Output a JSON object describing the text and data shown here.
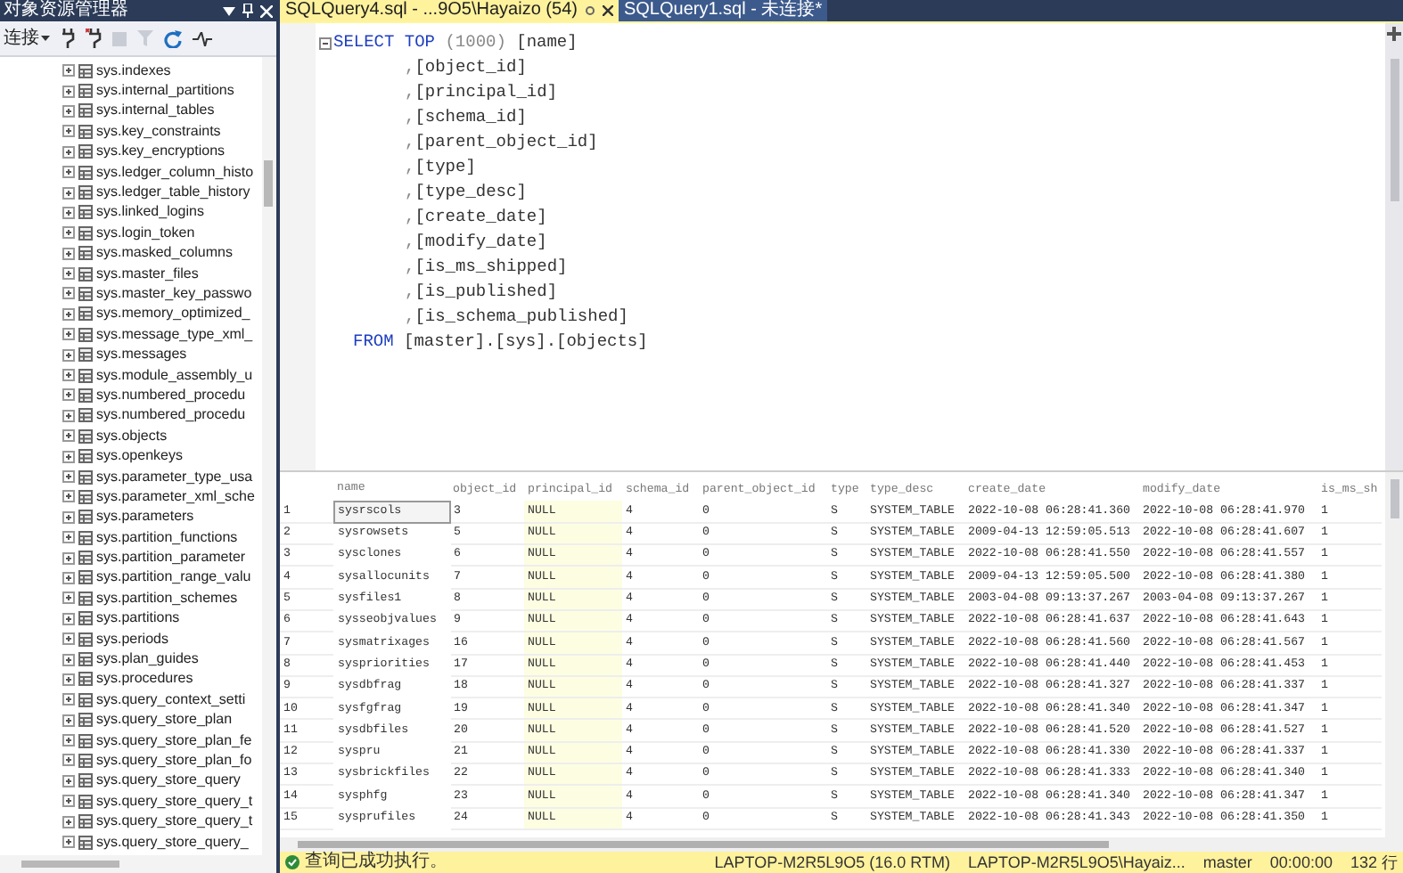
{
  "object_explorer": {
    "title": "对象资源管理器",
    "connect_label": "连接",
    "tree_items": [
      "sys.indexes",
      "sys.internal_partitions",
      "sys.internal_tables",
      "sys.key_constraints",
      "sys.key_encryptions",
      "sys.ledger_column_histo",
      "sys.ledger_table_history",
      "sys.linked_logins",
      "sys.login_token",
      "sys.masked_columns",
      "sys.master_files",
      "sys.master_key_passwo",
      "sys.memory_optimized_",
      "sys.message_type_xml_",
      "sys.messages",
      "sys.module_assembly_u",
      "sys.numbered_procedu",
      "sys.numbered_procedu",
      "sys.objects",
      "sys.openkeys",
      "sys.parameter_type_usa",
      "sys.parameter_xml_sche",
      "sys.parameters",
      "sys.partition_functions",
      "sys.partition_parameter",
      "sys.partition_range_valu",
      "sys.partition_schemes",
      "sys.partitions",
      "sys.periods",
      "sys.plan_guides",
      "sys.procedures",
      "sys.query_context_setti",
      "sys.query_store_plan",
      "sys.query_store_plan_fe",
      "sys.query_store_plan_fo",
      "sys.query_store_query",
      "sys.query_store_query_t",
      "sys.query_store_query_t",
      "sys.query_store_query_"
    ]
  },
  "tabs": [
    {
      "label": "SQLQuery4.sql - ...9O5\\Hayaizo (54)",
      "selected": true
    },
    {
      "label": "SQLQuery1.sql - 未连接*",
      "selected": false
    }
  ],
  "editor": {
    "lines": [
      {
        "kind": "select",
        "tokens": [
          {
            "kind": "keyword",
            "text": "SELECT TOP"
          },
          {
            "kind": "punct",
            "text": " (1000) "
          },
          {
            "kind": "ident",
            "text": "[name]"
          }
        ]
      },
      {
        "kind": "column",
        "tokens": [
          {
            "kind": "punct",
            "text": ","
          },
          {
            "kind": "ident",
            "text": "[object_id]"
          }
        ]
      },
      {
        "kind": "column",
        "tokens": [
          {
            "kind": "punct",
            "text": ","
          },
          {
            "kind": "ident",
            "text": "[principal_id]"
          }
        ]
      },
      {
        "kind": "column",
        "tokens": [
          {
            "kind": "punct",
            "text": ","
          },
          {
            "kind": "ident",
            "text": "[schema_id]"
          }
        ]
      },
      {
        "kind": "column",
        "tokens": [
          {
            "kind": "punct",
            "text": ","
          },
          {
            "kind": "ident",
            "text": "[parent_object_id]"
          }
        ]
      },
      {
        "kind": "column",
        "tokens": [
          {
            "kind": "punct",
            "text": ","
          },
          {
            "kind": "ident",
            "text": "[type]"
          }
        ]
      },
      {
        "kind": "column",
        "tokens": [
          {
            "kind": "punct",
            "text": ","
          },
          {
            "kind": "ident",
            "text": "[type_desc]"
          }
        ]
      },
      {
        "kind": "column",
        "tokens": [
          {
            "kind": "punct",
            "text": ","
          },
          {
            "kind": "ident",
            "text": "[create_date]"
          }
        ]
      },
      {
        "kind": "column",
        "tokens": [
          {
            "kind": "punct",
            "text": ","
          },
          {
            "kind": "ident",
            "text": "[modify_date]"
          }
        ]
      },
      {
        "kind": "column",
        "tokens": [
          {
            "kind": "punct",
            "text": ","
          },
          {
            "kind": "ident",
            "text": "[is_ms_shipped]"
          }
        ]
      },
      {
        "kind": "column",
        "tokens": [
          {
            "kind": "punct",
            "text": ","
          },
          {
            "kind": "ident",
            "text": "[is_published]"
          }
        ]
      },
      {
        "kind": "column",
        "tokens": [
          {
            "kind": "punct",
            "text": ","
          },
          {
            "kind": "ident",
            "text": "[is_schema_published]"
          }
        ]
      },
      {
        "kind": "from",
        "tokens": [
          {
            "kind": "keyword",
            "text": "FROM"
          },
          {
            "kind": "ident",
            "text": "[master].[sys].[objects]"
          }
        ]
      }
    ]
  },
  "results": {
    "columns": [
      "name",
      "object_id",
      "principal_id",
      "schema_id",
      "parent_object_id",
      "type",
      "type_desc",
      "create_date",
      "modify_date",
      "is_ms_sh"
    ],
    "rows": [
      {
        "number": "1",
        "focused": true,
        "cells": [
          "sysrscols",
          "3",
          "NULL",
          "4",
          "0",
          "S",
          "SYSTEM_TABLE",
          "2022-10-08 06:28:41.360",
          "2022-10-08 06:28:41.970",
          "1"
        ]
      },
      {
        "number": "2",
        "focused": false,
        "cells": [
          "sysrowsets",
          "5",
          "NULL",
          "4",
          "0",
          "S",
          "SYSTEM_TABLE",
          "2009-04-13 12:59:05.513",
          "2022-10-08 06:28:41.607",
          "1"
        ]
      },
      {
        "number": "3",
        "focused": false,
        "cells": [
          "sysclones",
          "6",
          "NULL",
          "4",
          "0",
          "S",
          "SYSTEM_TABLE",
          "2022-10-08 06:28:41.550",
          "2022-10-08 06:28:41.557",
          "1"
        ]
      },
      {
        "number": "4",
        "focused": false,
        "cells": [
          "sysallocunits",
          "7",
          "NULL",
          "4",
          "0",
          "S",
          "SYSTEM_TABLE",
          "2009-04-13 12:59:05.500",
          "2022-10-08 06:28:41.380",
          "1"
        ]
      },
      {
        "number": "5",
        "focused": false,
        "cells": [
          "sysfiles1",
          "8",
          "NULL",
          "4",
          "0",
          "S",
          "SYSTEM_TABLE",
          "2003-04-08 09:13:37.267",
          "2003-04-08 09:13:37.267",
          "1"
        ]
      },
      {
        "number": "6",
        "focused": false,
        "cells": [
          "sysseobjvalues",
          "9",
          "NULL",
          "4",
          "0",
          "S",
          "SYSTEM_TABLE",
          "2022-10-08 06:28:41.637",
          "2022-10-08 06:28:41.643",
          "1"
        ]
      },
      {
        "number": "7",
        "focused": false,
        "cells": [
          "sysmatrixages",
          "16",
          "NULL",
          "4",
          "0",
          "S",
          "SYSTEM_TABLE",
          "2022-10-08 06:28:41.560",
          "2022-10-08 06:28:41.567",
          "1"
        ]
      },
      {
        "number": "8",
        "focused": false,
        "cells": [
          "syspriorities",
          "17",
          "NULL",
          "4",
          "0",
          "S",
          "SYSTEM_TABLE",
          "2022-10-08 06:28:41.440",
          "2022-10-08 06:28:41.453",
          "1"
        ]
      },
      {
        "number": "9",
        "focused": false,
        "cells": [
          "sysdbfrag",
          "18",
          "NULL",
          "4",
          "0",
          "S",
          "SYSTEM_TABLE",
          "2022-10-08 06:28:41.327",
          "2022-10-08 06:28:41.337",
          "1"
        ]
      },
      {
        "number": "10",
        "focused": false,
        "cells": [
          "sysfgfrag",
          "19",
          "NULL",
          "4",
          "0",
          "S",
          "SYSTEM_TABLE",
          "2022-10-08 06:28:41.340",
          "2022-10-08 06:28:41.347",
          "1"
        ]
      },
      {
        "number": "11",
        "focused": false,
        "cells": [
          "sysdbfiles",
          "20",
          "NULL",
          "4",
          "0",
          "S",
          "SYSTEM_TABLE",
          "2022-10-08 06:28:41.520",
          "2022-10-08 06:28:41.527",
          "1"
        ]
      },
      {
        "number": "12",
        "focused": false,
        "cells": [
          "syspru",
          "21",
          "NULL",
          "4",
          "0",
          "S",
          "SYSTEM_TABLE",
          "2022-10-08 06:28:41.330",
          "2022-10-08 06:28:41.337",
          "1"
        ]
      },
      {
        "number": "13",
        "focused": false,
        "cells": [
          "sysbrickfiles",
          "22",
          "NULL",
          "4",
          "0",
          "S",
          "SYSTEM_TABLE",
          "2022-10-08 06:28:41.333",
          "2022-10-08 06:28:41.340",
          "1"
        ]
      },
      {
        "number": "14",
        "focused": false,
        "cells": [
          "sysphfg",
          "23",
          "NULL",
          "4",
          "0",
          "S",
          "SYSTEM_TABLE",
          "2022-10-08 06:28:41.340",
          "2022-10-08 06:28:41.347",
          "1"
        ]
      },
      {
        "number": "15",
        "focused": false,
        "cells": [
          "sysprufiles",
          "24",
          "NULL",
          "4",
          "0",
          "S",
          "SYSTEM_TABLE",
          "2022-10-08 06:28:41.343",
          "2022-10-08 06:28:41.350",
          "1"
        ]
      }
    ]
  },
  "status_bar": {
    "message": "查询已成功执行。",
    "server": "LAPTOP-M2R5L9O5 (16.0 RTM)",
    "user": "LAPTOP-M2R5L9O5\\Hayaiz...",
    "database": "master",
    "elapsed": "00:00:00",
    "row_count": "132 行"
  }
}
